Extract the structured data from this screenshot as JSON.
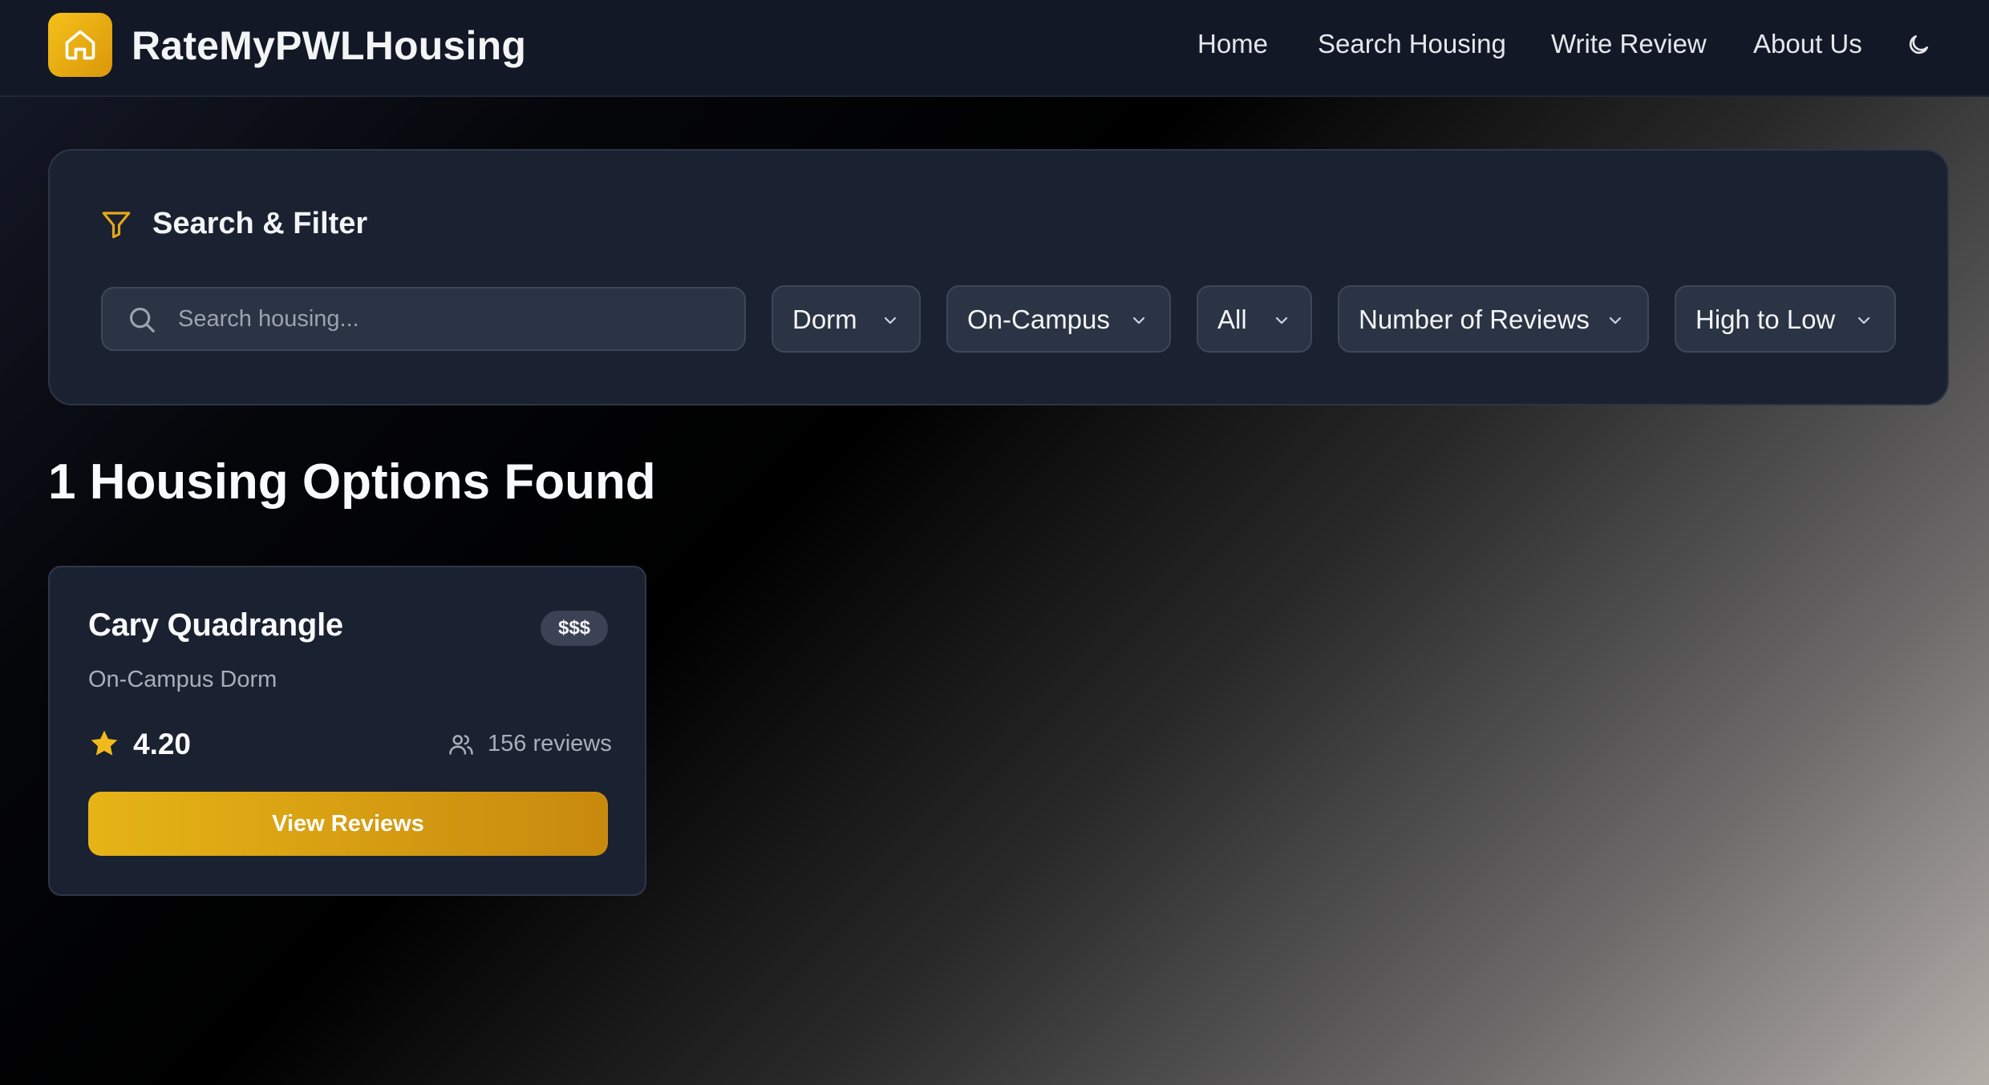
{
  "header": {
    "brand": "RateMyPWLHousing",
    "nav": [
      "Home",
      "Search Housing",
      "Write Review",
      "About Us"
    ],
    "theme_icon": "moon-icon",
    "logo_icon": "home-icon"
  },
  "filter": {
    "title": "Search & Filter",
    "title_icon": "filter-icon",
    "search_placeholder": "Search housing...",
    "search_value": "",
    "selects": {
      "type": "Dorm",
      "location": "On-Campus",
      "price": "All",
      "sort_by": "Number of Reviews",
      "order": "High to Low"
    }
  },
  "results": {
    "title": "1 Housing Options Found",
    "cards": [
      {
        "name": "Cary Quadrangle",
        "price": "$$$",
        "subtitle": "On-Campus Dorm",
        "rating": "4.20",
        "reviews": "156 reviews",
        "button": "View Reviews"
      }
    ]
  },
  "colors": {
    "accent": "#e6b416",
    "accent_dark": "#c8890e",
    "header_bg": "#121826",
    "panel_bg": "#1a2130"
  }
}
